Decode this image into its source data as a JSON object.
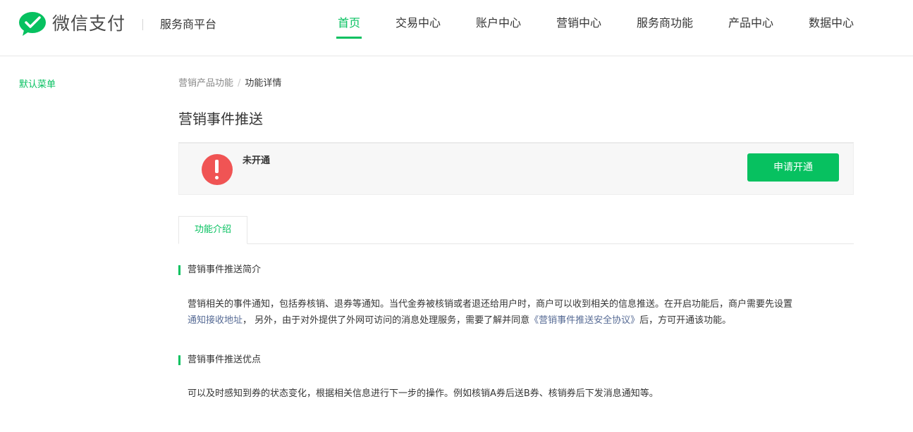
{
  "header": {
    "logo_text": "微信支付",
    "platform": "服务商平台",
    "nav": [
      {
        "label": "首页",
        "active": true
      },
      {
        "label": "交易中心"
      },
      {
        "label": "账户中心"
      },
      {
        "label": "营销中心"
      },
      {
        "label": "服务商功能"
      },
      {
        "label": "产品中心"
      },
      {
        "label": "数据中心"
      }
    ]
  },
  "sidebar": {
    "items": [
      {
        "label": "默认菜单"
      }
    ]
  },
  "breadcrumb": {
    "parent": "营销产品功能",
    "separator": "/",
    "current": "功能详情"
  },
  "page_title": "营销事件推送",
  "status": {
    "text": "未开通",
    "icon": "exclamation-icon",
    "button_label": "申请开通"
  },
  "tabs": [
    {
      "label": "功能介绍",
      "active": true
    }
  ],
  "sections": [
    {
      "title": "营销事件推送简介",
      "para_part1": "营销相关的事件通知，包括券核销、退券等通知。当代金券被核销或者退还给用户时，商户可以收到相关的信息推送。在开启功能后，商户需要先设置",
      "link1": "通知接收地址",
      "para_part2": "， 另外，由于对外提供了外网可访问的消息处理服务，需要了解并同意",
      "link2": "《营销事件推送安全协议》",
      "para_part3": "后，方可开通该功能。"
    },
    {
      "title": "营销事件推送优点",
      "text": "可以及时感知到券的状态变化，根据相关信息进行下一步的操作。例如核销A券后送B券、核销券后下发消息通知等。"
    }
  ],
  "colors": {
    "accent": "#07c160",
    "link": "#576b95",
    "error": "#f05454"
  }
}
